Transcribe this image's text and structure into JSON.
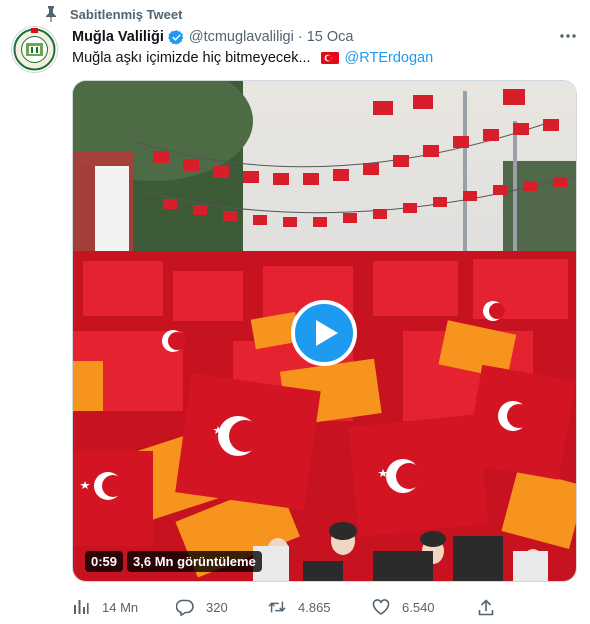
{
  "pinned": {
    "label": "Sabitlenmiş Tweet",
    "icon": "pin-icon"
  },
  "author": {
    "avatar_text_top": "MUĞLA VALİLİĞİ",
    "name": "Muğla Valiliği",
    "handle": "@tcmuglavaliligi",
    "separator": "·",
    "time": "15 Oca",
    "verified_icon": "verified-badge-icon"
  },
  "tweet": {
    "text": "Muğla aşkı içimizde hiç bitmeyecek...",
    "flag_icon": "turkey-flag-icon",
    "mention": "@RTErdogan"
  },
  "media": {
    "duration": "0:59",
    "views": "3,6 Mn görüntüleme",
    "play_icon": "play-icon"
  },
  "actions": {
    "analytics": {
      "icon": "analytics-icon",
      "count": "14 Mn"
    },
    "reply": {
      "icon": "reply-icon",
      "count": "320"
    },
    "retweet": {
      "icon": "retweet-icon",
      "count": "4.865"
    },
    "like": {
      "icon": "heart-icon",
      "count": "6.540"
    },
    "share": {
      "icon": "share-icon",
      "count": ""
    }
  },
  "colors": {
    "accent": "#1d9bf0",
    "text_primary": "#0f1419",
    "text_secondary": "#536471",
    "flag_red": "#e30a17",
    "party_orange": "#f7941d"
  }
}
